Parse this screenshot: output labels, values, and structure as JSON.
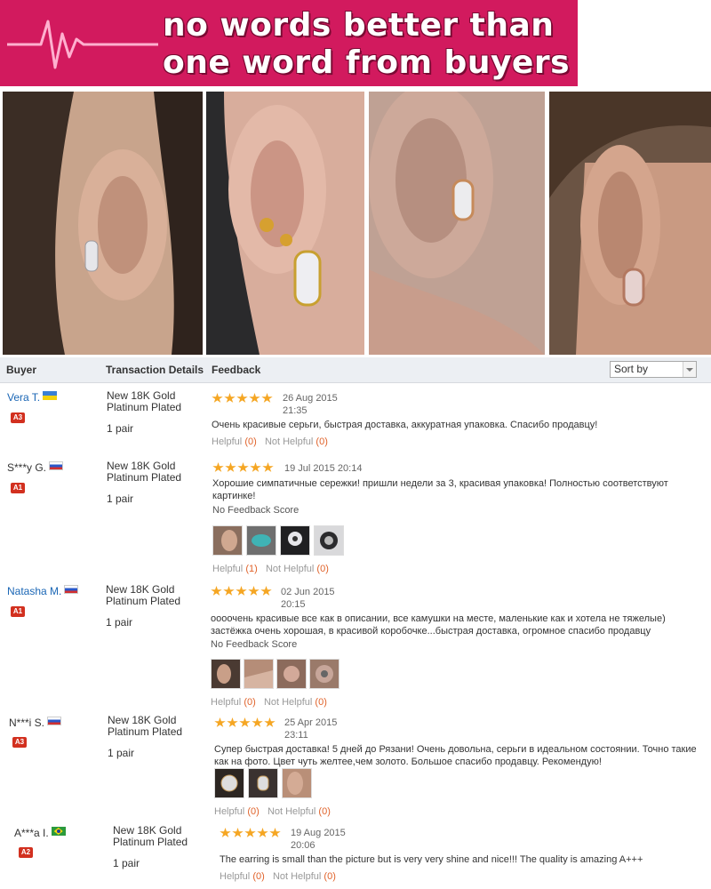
{
  "banner": {
    "line1": "no words better than",
    "line2": "one word from buyers",
    "bg_color": "#d21a5e",
    "icon": "heartbeat-icon"
  },
  "photos": [
    {
      "name": "buyer-photo-1"
    },
    {
      "name": "buyer-photo-2"
    },
    {
      "name": "buyer-photo-3"
    },
    {
      "name": "buyer-photo-4"
    }
  ],
  "table": {
    "headers": {
      "buyer": "Buyer",
      "transaction": "Transaction Details",
      "feedback": "Feedback"
    },
    "sort_label": "Sort by"
  },
  "reviews": [
    {
      "buyer": "Vera T.",
      "flag": "ua",
      "badge": "A3",
      "product": "New 18K Gold Platinum Plated",
      "qty": "1 pair",
      "date": "26 Aug 2015",
      "time": "21:35",
      "stars": 5,
      "text": "Очень красивые серьги, быстрая доставка, аккуратная упаковка. Спасибо продавцу!",
      "helpful_label": "Helpful",
      "helpful_count": "(0)",
      "not_helpful_label": "Not Helpful",
      "not_helpful_count": "(0)"
    },
    {
      "buyer": "S***y G.",
      "flag": "ru",
      "badge": "A1",
      "product": "New 18K Gold Platinum Plated",
      "qty": "1 pair",
      "date": "19 Jul 2015 20:14",
      "stars": 5,
      "text": "Хорошие симпатичные сережки! пришли недели за 3, красивая упаковка! Полностью соответствуют картинке!",
      "no_score": "No Feedback Score",
      "helpful_label": "Helpful",
      "helpful_count": "(1)",
      "not_helpful_label": "Not Helpful",
      "not_helpful_count": "(0)"
    },
    {
      "buyer": "Natasha M.",
      "flag": "ru",
      "badge": "A1",
      "product": "New 18K Gold Platinum Plated",
      "qty": "1 pair",
      "date": "02 Jun 2015",
      "time": "20:15",
      "stars": 5,
      "text": "оооочень красивые все как в описании, все камушки на месте, маленькие как и хотела не тяжелые) застёжка очень хорошая, в красивой коробочке...быстрая доставка, огромное спасибо продавцу",
      "no_score": "No Feedback Score",
      "helpful_label": "Helpful",
      "helpful_count": "(0)",
      "not_helpful_label": "Not Helpful",
      "not_helpful_count": "(0)"
    },
    {
      "buyer": "N***i S.",
      "flag": "ru",
      "badge": "A3",
      "product": "New 18K Gold Platinum Plated",
      "qty": "1 pair",
      "date": "25 Apr 2015",
      "time": "23:11",
      "stars": 5,
      "text": "Супер быстрая доставка! 5 дней до Рязани! Очень довольна, серьги в идеальном состоянии. Точно такие как на фото. Цвет чуть желтее,чем золото. Большое спасибо продавцу. Рекомендую!",
      "helpful_label": "Helpful",
      "helpful_count": "(0)",
      "not_helpful_label": "Not Helpful",
      "not_helpful_count": "(0)"
    },
    {
      "buyer": "A***a I.",
      "flag": "br",
      "badge": "A2",
      "product": "New 18K Gold Platinum Plated",
      "qty": "1 pair",
      "date": "19 Aug 2015",
      "time": "20:06",
      "stars": 5,
      "text": "The earring is small than the picture but is very very shine and nice!!! The quality is amazing A+++",
      "helpful_label": "Helpful",
      "helpful_count": "(0)",
      "not_helpful_label": "Not Helpful",
      "not_helpful_count": "(0)"
    }
  ],
  "colors": {
    "link": "#1a66b5",
    "star": "#f5a623",
    "badge": "#d2301f",
    "count": "#e0632b"
  }
}
